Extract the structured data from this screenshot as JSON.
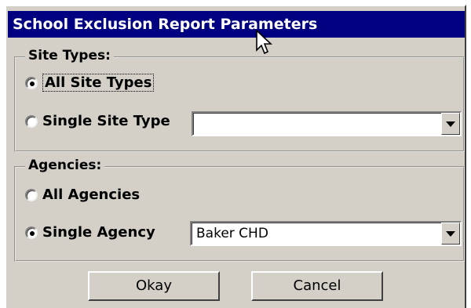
{
  "dialog": {
    "title": "School Exclusion Report Parameters"
  },
  "site_types": {
    "legend": "Site Types:",
    "options": [
      {
        "label": "All Site Types",
        "checked": true
      },
      {
        "label": "Single Site Type",
        "checked": false
      }
    ],
    "select_value": ""
  },
  "agencies": {
    "legend": "Agencies:",
    "options": [
      {
        "label": "All Agencies",
        "checked": false
      },
      {
        "label": "Single Agency",
        "checked": true
      }
    ],
    "select_value": "Baker CHD"
  },
  "buttons": {
    "okay": "Okay",
    "cancel": "Cancel"
  },
  "colors": {
    "titlebar": "#000080",
    "face": "#d4d0c8"
  },
  "icons": {
    "cursor": "mouse-pointer-icon",
    "dropdown": "chevron-down-icon"
  }
}
